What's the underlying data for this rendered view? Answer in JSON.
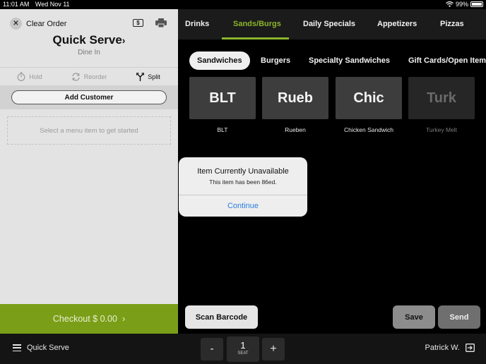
{
  "status_bar": {
    "time": "11:01 AM",
    "date": "Wed Nov 11",
    "battery": "99%"
  },
  "order": {
    "clear_label": "Clear Order",
    "cash_symbol": "$",
    "title": "Quick Serve",
    "title_chevron": "›",
    "subtitle": "Dine In",
    "actions": {
      "hold": "Hold",
      "reorder": "Reorder",
      "split": "Split"
    },
    "add_customer_label": "Add Customer",
    "empty_message": "Select a menu item to get started",
    "checkout_label": "Checkout $ 0.00",
    "checkout_chevron": "›"
  },
  "categories": {
    "tabs": [
      {
        "label": "Drinks"
      },
      {
        "label": "Sands/Burgs"
      },
      {
        "label": "Daily Specials"
      },
      {
        "label": "Appetizers"
      },
      {
        "label": "Pizzas"
      }
    ]
  },
  "subcategories": {
    "tabs": [
      {
        "label": "Sandwiches"
      },
      {
        "label": "Burgers"
      },
      {
        "label": "Specialty Sandwiches"
      },
      {
        "label": "Gift Cards/Open Item"
      }
    ]
  },
  "menu_items": [
    {
      "tile": "BLT",
      "label": "BLT"
    },
    {
      "tile": "Rueb",
      "label": "Rueben"
    },
    {
      "tile": "Chic",
      "label": "Chicken Sandwich"
    },
    {
      "tile": "Turk",
      "label": "Turkey Melt"
    }
  ],
  "alert": {
    "title": "Item Currently Unavailable",
    "message": "This item has been 86ed.",
    "button": "Continue"
  },
  "footer_actions": {
    "scan": "Scan Barcode",
    "save": "Save",
    "send": "Send"
  },
  "bottom_bar": {
    "menu_label": "Quick Serve",
    "minus": "-",
    "seat_number": "1",
    "seat_label": "SEAT",
    "plus": "+",
    "user": "Patrick W."
  },
  "colors": {
    "accent": "#8bb42a",
    "checkout_bg": "#7a9e17",
    "link_blue": "#2a7de1"
  }
}
